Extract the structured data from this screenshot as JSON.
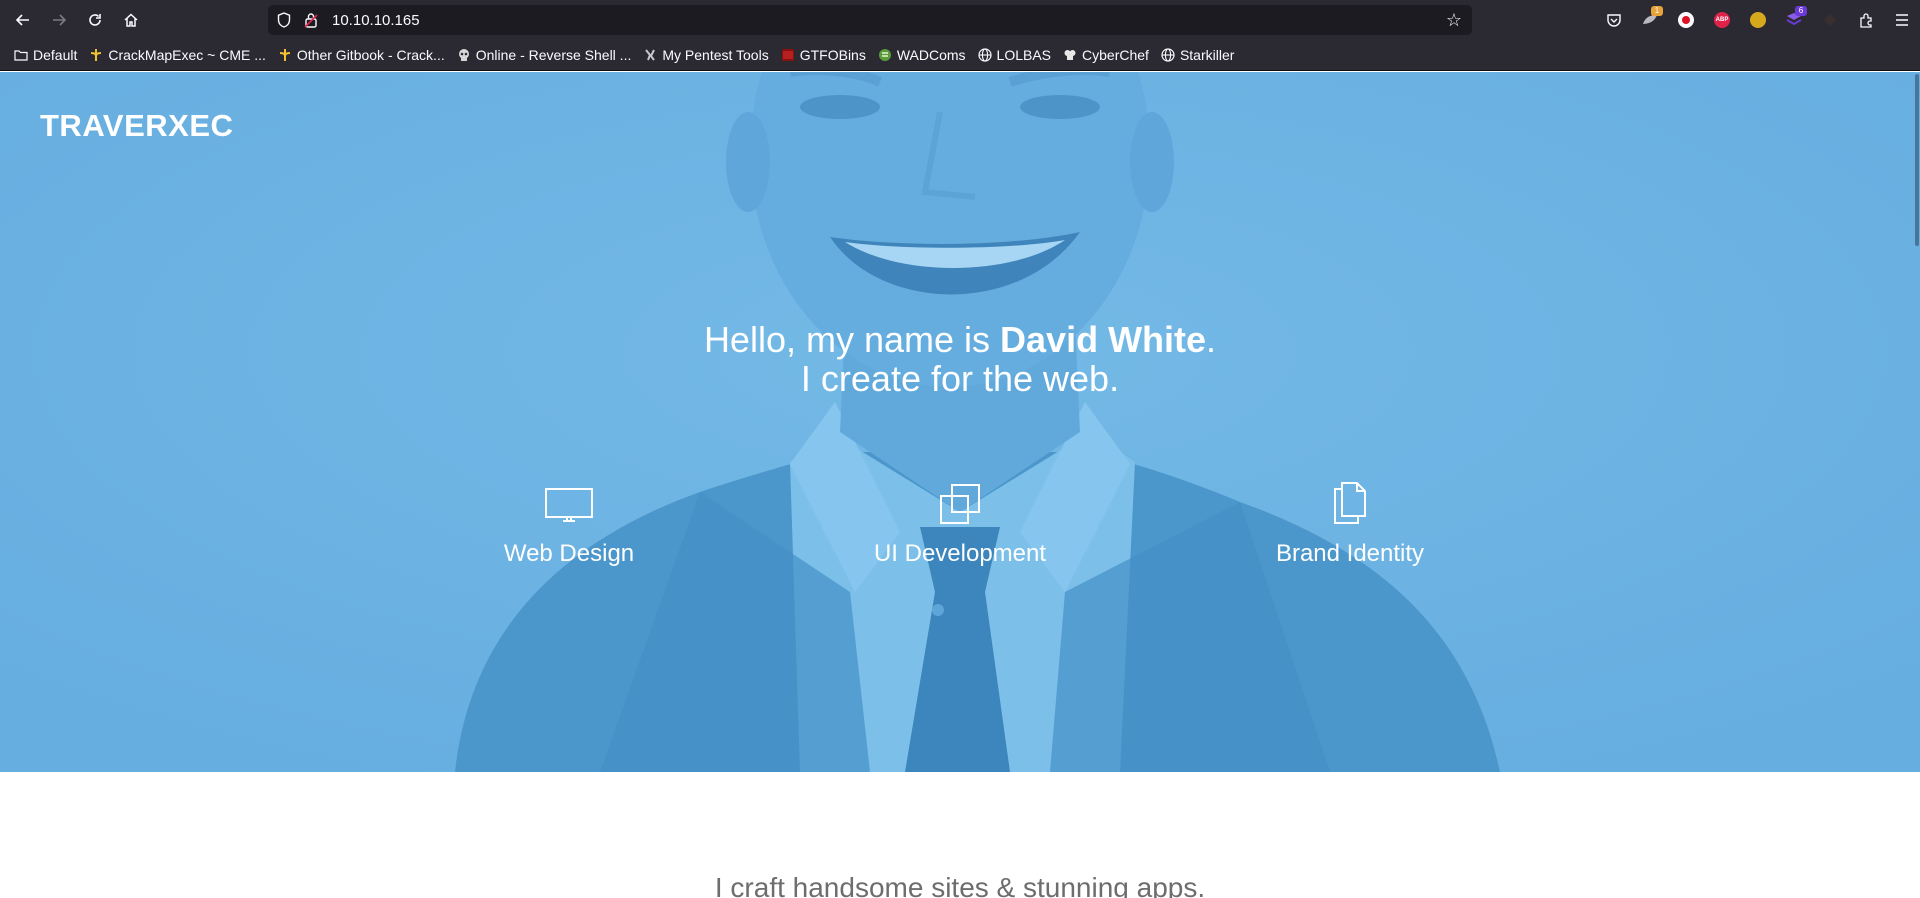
{
  "browser": {
    "url": "10.10.10.165",
    "extensions": [
      {
        "name": "pocket-icon"
      },
      {
        "name": "foxyproxy-icon",
        "badge": "1",
        "badge_color": "#e8a33a"
      },
      {
        "name": "sync-icon"
      },
      {
        "name": "adblock-icon",
        "label": "ABP",
        "color": "#e0224b"
      },
      {
        "name": "coin-icon",
        "color": "#d6a91d"
      },
      {
        "name": "wappalyzer-icon",
        "badge": "6",
        "badge_color": "#6b39d6"
      },
      {
        "name": "shield-extension-icon"
      },
      {
        "name": "extensions-icon"
      },
      {
        "name": "menu-icon"
      }
    ]
  },
  "bookmarks": [
    {
      "label": "Default",
      "icon": "folder-icon"
    },
    {
      "label": "CrackMapExec ~ CME ...",
      "icon": "gitbook-icon"
    },
    {
      "label": "Other Gitbook - Crack...",
      "icon": "gitbook-icon"
    },
    {
      "label": "Online - Reverse Shell ...",
      "icon": "skull-icon"
    },
    {
      "label": "My Pentest Tools",
      "icon": "tools-icon"
    },
    {
      "label": "GTFOBins",
      "icon": "gtfobins-icon"
    },
    {
      "label": "WADComs",
      "icon": "wadcoms-icon"
    },
    {
      "label": "LOLBAS",
      "icon": "globe-icon"
    },
    {
      "label": "CyberChef",
      "icon": "chef-icon"
    },
    {
      "label": "Starkiller",
      "icon": "globe-icon"
    }
  ],
  "site": {
    "logo": "TRAVERXEC",
    "intro_prefix": "Hello, my name is ",
    "intro_name": "David White",
    "intro_suffix": ".",
    "intro_line2": "I create for the web.",
    "services": [
      {
        "label": "Web Design",
        "icon": "monitor-icon"
      },
      {
        "label": "UI Development",
        "icon": "layers-icon"
      },
      {
        "label": "Brand Identity",
        "icon": "documents-icon"
      }
    ],
    "tagline": "I craft handsome sites & stunning apps."
  },
  "colors": {
    "hero_blue": "#6ab2e2",
    "chrome_bg": "#2b2a33",
    "urlbar_bg": "#1c1b22"
  }
}
